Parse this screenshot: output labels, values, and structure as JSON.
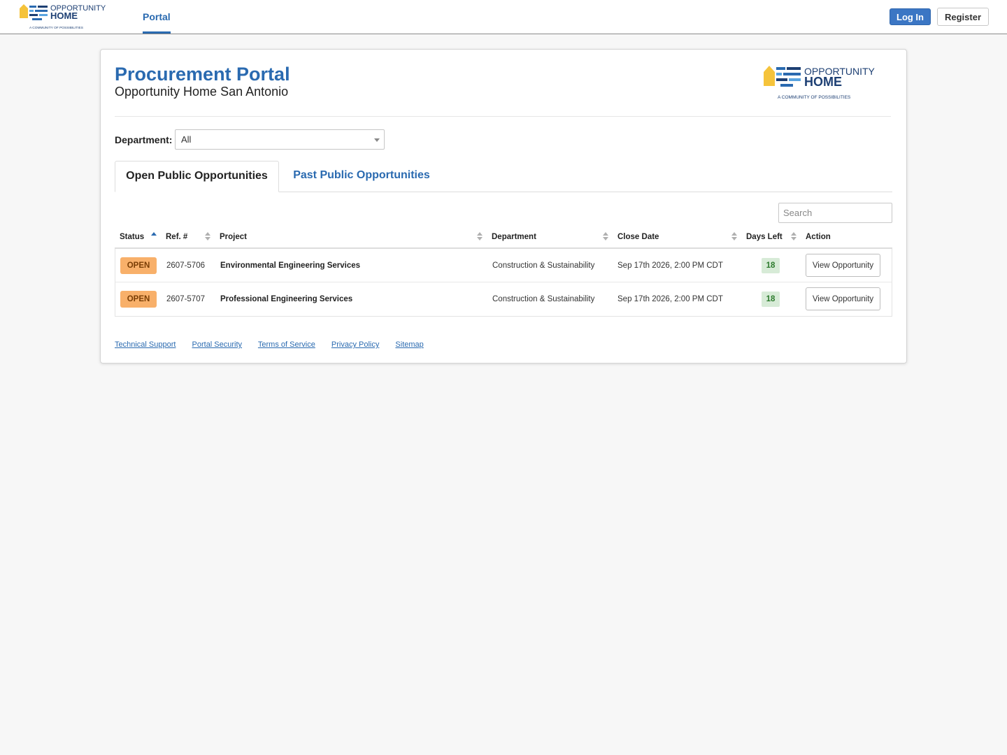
{
  "header": {
    "logo_brand_line1": "OPPORTUNITY",
    "logo_brand_line2": "HOME",
    "logo_tagline": "A COMMUNITY OF POSSIBILITIES",
    "nav_portal": "Portal",
    "login_label": "Log In",
    "register_label": "Register"
  },
  "page": {
    "title": "Procurement Portal",
    "subtitle": "Opportunity Home San Antonio"
  },
  "filter": {
    "department_label": "Department:",
    "department_value": "All"
  },
  "tabs": [
    {
      "label": "Open Public Opportunities",
      "active": true
    },
    {
      "label": "Past Public Opportunities",
      "active": false
    }
  ],
  "search": {
    "placeholder": "Search"
  },
  "table": {
    "columns": [
      "Status",
      "Ref. #",
      "Project",
      "Department",
      "Close Date",
      "Days Left",
      "Action"
    ],
    "rows": [
      {
        "status": "OPEN",
        "ref": "2607-5706",
        "project": "Environmental Engineering Services",
        "department": "Construction & Sustainability",
        "close_date": "Sep 17th 2026, 2:00 PM CDT",
        "days_left": "18",
        "action": "View Opportunity"
      },
      {
        "status": "OPEN",
        "ref": "2607-5707",
        "project": "Professional Engineering Services",
        "department": "Construction & Sustainability",
        "close_date": "Sep 17th 2026, 2:00 PM CDT",
        "days_left": "18",
        "action": "View Opportunity"
      }
    ]
  },
  "footer": {
    "links": [
      "Technical Support",
      "Portal Security",
      "Terms of Service",
      "Privacy Policy",
      "Sitemap"
    ]
  },
  "colors": {
    "brand_blue": "#2a6ab0",
    "logo_yellow": "#f5c33b",
    "status_open": "#f8b06a",
    "days_left_bg": "#d7ebd7"
  }
}
